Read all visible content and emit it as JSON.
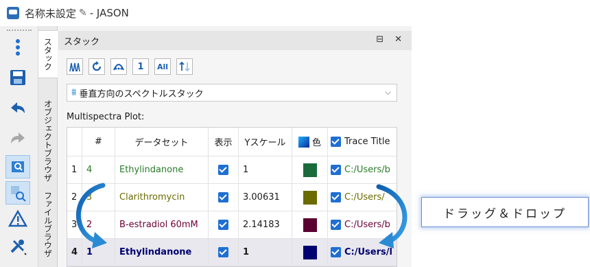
{
  "window": {
    "title": "名称未設定",
    "app": "- JASON"
  },
  "vertical_tabs": [
    "スタック",
    "オブジェクトブラウザ",
    "ファイルブラウザ"
  ],
  "panel": {
    "title": "スタック",
    "pin_glyph": "⊟",
    "close_glyph": "✕",
    "icon_buttons": [
      "1",
      "All"
    ],
    "dropdown_value": "垂直方向のスペクトルスタック",
    "subtitle": "Multispectra Plot:"
  },
  "table": {
    "headers": [
      "",
      "#",
      "データセット",
      "表示",
      "Yスケール",
      "色",
      "Trace Title"
    ],
    "rows": [
      {
        "index": "1",
        "num": "4",
        "dataset": "Ethylindanone",
        "scale": "1",
        "color": "#1a6b3c",
        "text_color": "#2a7a2a",
        "trace": "C:/Users/b",
        "selected": false
      },
      {
        "index": "2",
        "num": "3",
        "dataset": "Clarithromycin",
        "scale": "3.00631",
        "color": "#6b6b00",
        "text_color": "#6b6b00",
        "trace": "C:/Users/",
        "selected": false
      },
      {
        "index": "3",
        "num": "2",
        "dataset": "B-estradiol 60mM",
        "scale": "2.14183",
        "color": "#5a0030",
        "text_color": "#6a0035",
        "trace": "C:/Users/b",
        "selected": false
      },
      {
        "index": "4",
        "num": "1",
        "dataset": "Ethylindanone",
        "scale": "1",
        "color": "#000070",
        "text_color": "#000070",
        "trace": "C:/Users/l",
        "selected": true
      }
    ]
  },
  "callout": {
    "text": "ドラッグ＆ドロップ"
  },
  "colors": {
    "accent": "#1f6fd1",
    "arrow": "#2a8ad4"
  }
}
